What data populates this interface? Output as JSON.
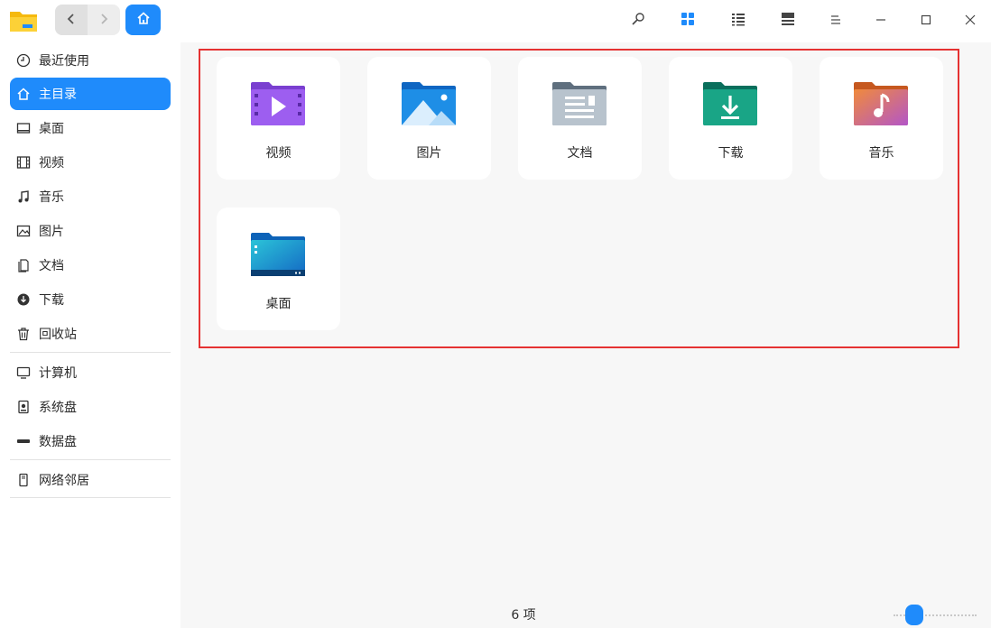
{
  "titlebar": {
    "icons": [
      "folder-app-icon",
      "back-icon",
      "forward-icon",
      "home-icon",
      "search-icon",
      "icon-view-icon",
      "list-view-icon",
      "tree-view-icon",
      "menu-icon",
      "minimize-icon",
      "maximize-icon",
      "close-icon"
    ]
  },
  "sidebar": {
    "items": [
      {
        "label": "最近使用",
        "icon": "clock-icon"
      },
      {
        "label": "主目录",
        "icon": "home-icon",
        "active": true
      },
      {
        "label": "桌面",
        "icon": "desktop-icon"
      },
      {
        "label": "视频",
        "icon": "film-icon"
      },
      {
        "label": "音乐",
        "icon": "music-icon"
      },
      {
        "label": "图片",
        "icon": "image-icon"
      },
      {
        "label": "文档",
        "icon": "document-icon"
      },
      {
        "label": "下载",
        "icon": "download-icon"
      },
      {
        "label": "回收站",
        "icon": "trash-icon"
      },
      {
        "label": "计算机",
        "icon": "computer-icon"
      },
      {
        "label": "系统盘",
        "icon": "system-disk-icon"
      },
      {
        "label": "数据盘",
        "icon": "data-disk-icon"
      },
      {
        "label": "网络邻居",
        "icon": "network-icon"
      }
    ]
  },
  "main": {
    "folders": [
      {
        "label": "视频",
        "icon": "video-folder-icon",
        "color": "#8b4fe0"
      },
      {
        "label": "图片",
        "icon": "pictures-folder-icon",
        "color": "#1a82d8"
      },
      {
        "label": "文档",
        "icon": "documents-folder-icon",
        "color": "#7e8d9c"
      },
      {
        "label": "下载",
        "icon": "downloads-folder-icon",
        "color": "#11937a"
      },
      {
        "label": "音乐",
        "icon": "music-folder-icon",
        "color": "#e0734a"
      },
      {
        "label": "桌面",
        "icon": "desktop-folder-icon",
        "color": "#1a9fd0"
      }
    ],
    "status": "6 项"
  },
  "colors": {
    "accent": "#1f8bfb",
    "highlight": "#e53232"
  }
}
